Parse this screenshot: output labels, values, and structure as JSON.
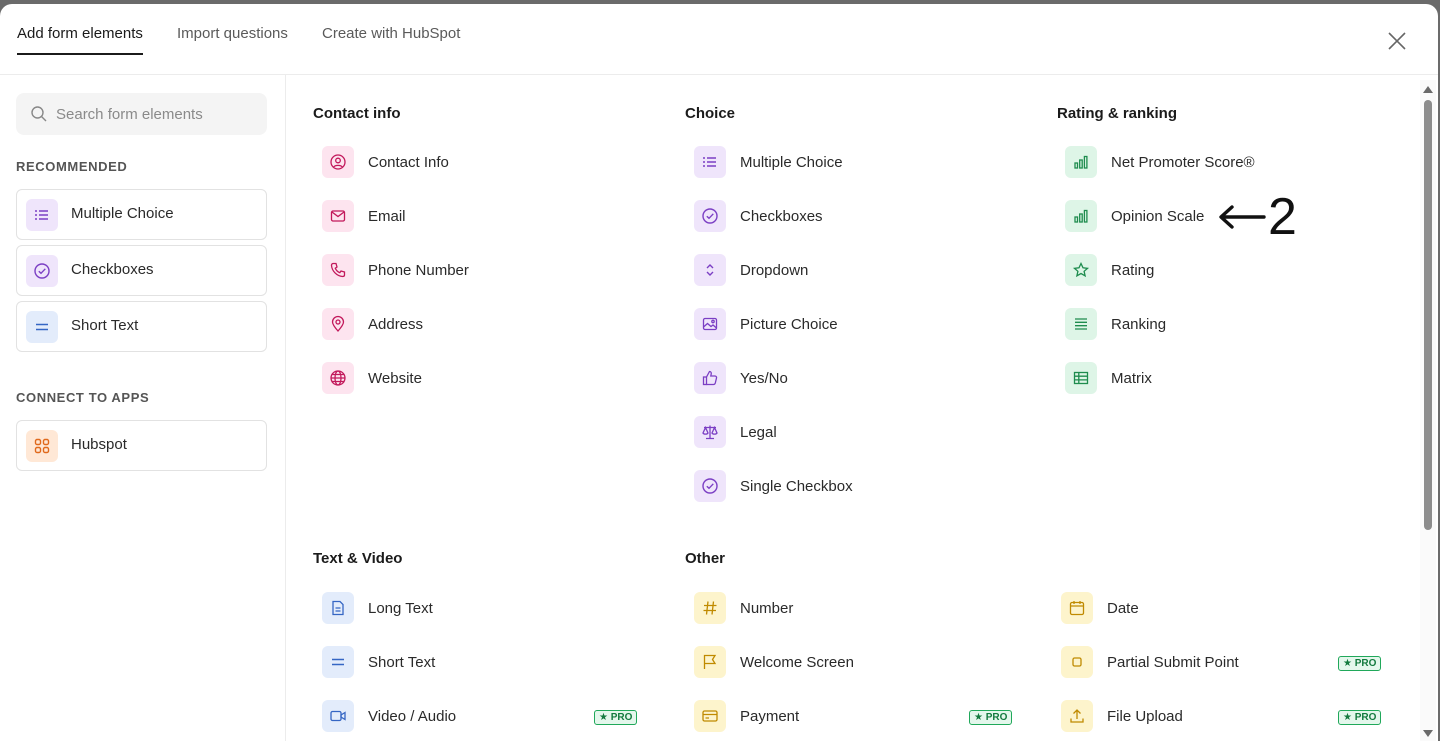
{
  "tabs": [
    {
      "label": "Add form elements",
      "active": true
    },
    {
      "label": "Import questions"
    },
    {
      "label": "Create with HubSpot"
    }
  ],
  "search": {
    "placeholder": "Search form elements"
  },
  "sidebar": {
    "recommended_heading": "RECOMMENDED",
    "recommended": [
      {
        "label": "Multiple Choice",
        "icon": "list-icon"
      },
      {
        "label": "Checkboxes",
        "icon": "check-circle-icon"
      },
      {
        "label": "Short Text",
        "icon": "short-text-icon"
      }
    ],
    "connect_heading": "CONNECT TO APPS",
    "apps": [
      {
        "label": "Hubspot",
        "icon": "apps-grid-icon"
      }
    ]
  },
  "sections": {
    "contact": {
      "title": "Contact info",
      "items": [
        {
          "label": "Contact Info",
          "icon": "user-circle-icon"
        },
        {
          "label": "Email",
          "icon": "mail-icon"
        },
        {
          "label": "Phone Number",
          "icon": "phone-icon"
        },
        {
          "label": "Address",
          "icon": "map-pin-icon"
        },
        {
          "label": "Website",
          "icon": "globe-icon"
        }
      ]
    },
    "choice": {
      "title": "Choice",
      "items": [
        {
          "label": "Multiple Choice",
          "icon": "list-icon"
        },
        {
          "label": "Checkboxes",
          "icon": "check-circle-icon"
        },
        {
          "label": "Dropdown",
          "icon": "chevron-updown-icon"
        },
        {
          "label": "Picture Choice",
          "icon": "image-icon"
        },
        {
          "label": "Yes/No",
          "icon": "thumbs-up-icon"
        },
        {
          "label": "Legal",
          "icon": "scale-icon"
        },
        {
          "label": "Single Checkbox",
          "icon": "check-circle-icon"
        }
      ]
    },
    "rating": {
      "title": "Rating & ranking",
      "items": [
        {
          "label": "Net Promoter Score®",
          "icon": "bar-chart-icon"
        },
        {
          "label": "Opinion Scale",
          "icon": "bar-chart-icon"
        },
        {
          "label": "Rating",
          "icon": "star-icon"
        },
        {
          "label": "Ranking",
          "icon": "ranking-icon"
        },
        {
          "label": "Matrix",
          "icon": "table-icon"
        }
      ]
    },
    "text_video": {
      "title": "Text & Video",
      "items": [
        {
          "label": "Long Text",
          "icon": "document-icon"
        },
        {
          "label": "Short Text",
          "icon": "short-text-icon"
        },
        {
          "label": "Video / Audio",
          "icon": "video-icon",
          "badge": "★ PRO"
        }
      ]
    },
    "other": {
      "title": "Other",
      "items": [
        {
          "label": "Number",
          "icon": "hash-icon"
        },
        {
          "label": "Welcome Screen",
          "icon": "flag-icon"
        },
        {
          "label": "Payment",
          "icon": "credit-card-icon",
          "badge": "★ PRO"
        }
      ]
    },
    "other2": {
      "items": [
        {
          "label": "Date",
          "icon": "calendar-icon"
        },
        {
          "label": "Partial Submit Point",
          "icon": "square-icon",
          "badge": "★ PRO"
        },
        {
          "label": "File Upload",
          "icon": "upload-icon",
          "badge": "★ PRO"
        }
      ]
    }
  },
  "annotation": {
    "text": "2"
  }
}
